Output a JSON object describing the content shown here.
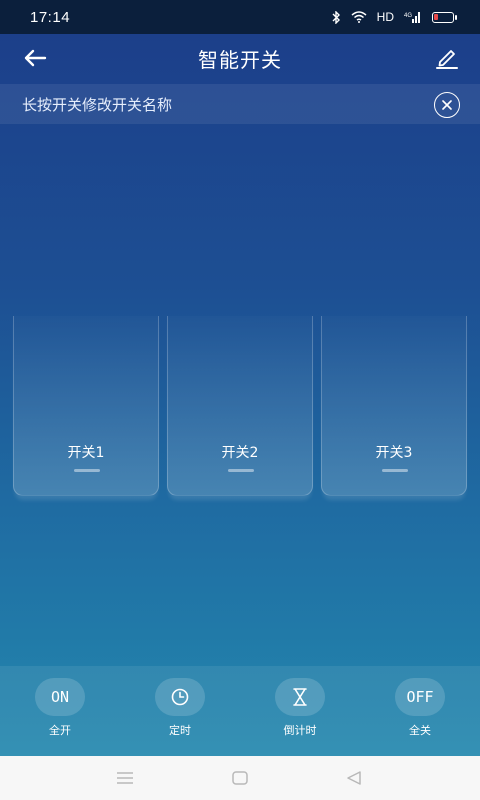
{
  "status_bar": {
    "time": "17:14",
    "network": "HD",
    "signal_label": "4G"
  },
  "header": {
    "title": "智能开关"
  },
  "tip": {
    "text": "长按开关修改开关名称"
  },
  "switches": [
    {
      "label": "开关1"
    },
    {
      "label": "开关2"
    },
    {
      "label": "开关3"
    }
  ],
  "actions": [
    {
      "icon_text": "ON",
      "label": "全开"
    },
    {
      "icon": "clock-icon",
      "label": "定时"
    },
    {
      "icon": "hourglass-icon",
      "label": "倒计时"
    },
    {
      "icon_text": "OFF",
      "label": "全关"
    }
  ],
  "colors": {
    "gradient_top": "#1c3f8a",
    "gradient_bottom": "#2388ae",
    "status_bar_bg": "#0b1f3c"
  }
}
